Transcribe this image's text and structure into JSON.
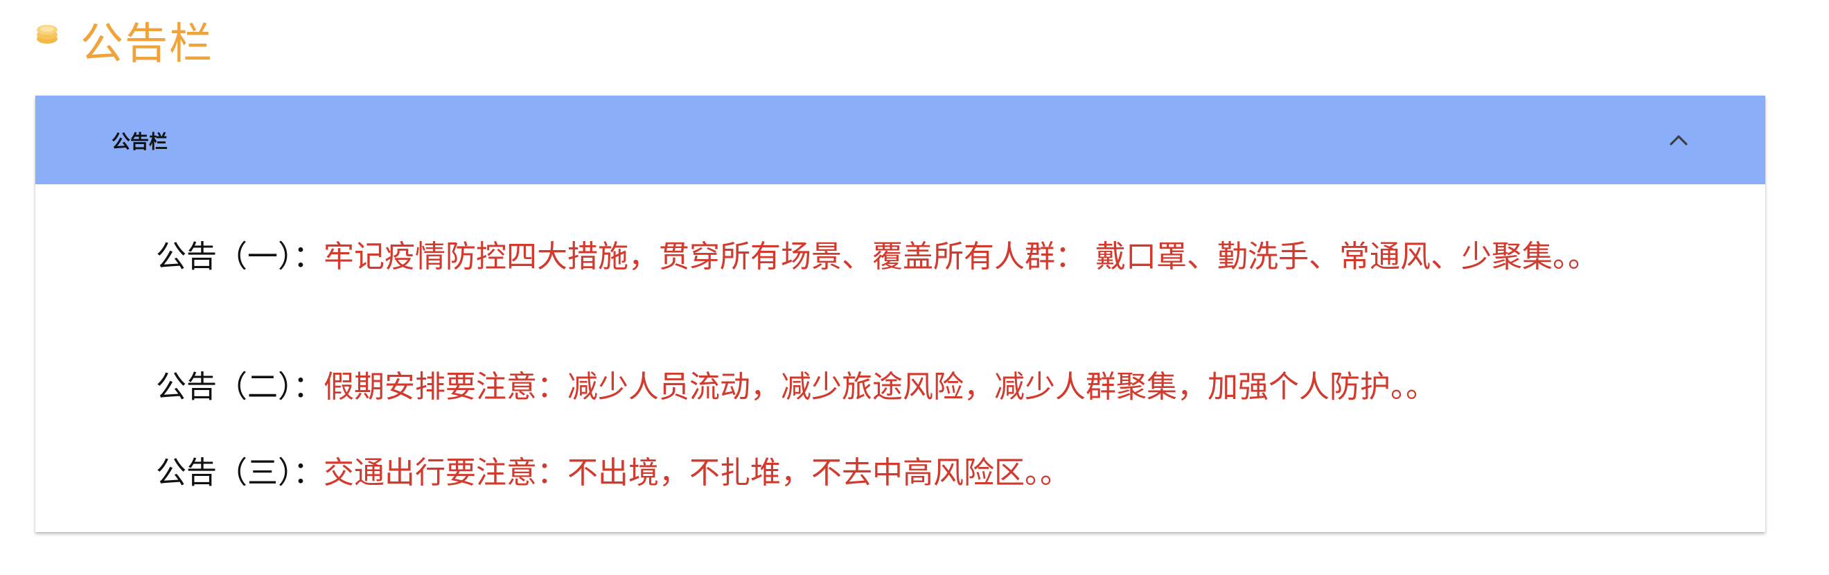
{
  "page": {
    "title": "公告栏",
    "title_color": "#f0a33a",
    "icon": "coin-stack-icon"
  },
  "panel": {
    "header_title": "公告栏",
    "header_bg": "#8aaff8",
    "collapse_icon": "chevron-up-icon",
    "expanded": true
  },
  "notices": [
    {
      "label": "公告（一）：",
      "content": "牢记疫情防控四大措施，贯穿所有场景、覆盖所有人群： 戴口罩、勤洗手、常通风、少聚集。。"
    },
    {
      "label": "公告（二）：",
      "content": "假期安排要注意：减少人员流动，减少旅途风险，减少人群聚集，加强个人防护。。"
    },
    {
      "label": "公告（三）：",
      "content": "交通出行要注意：不出境，不扎堆，不去中高风险区。。"
    }
  ],
  "colors": {
    "notice_label": "#111111",
    "notice_content": "#d23a2e"
  }
}
